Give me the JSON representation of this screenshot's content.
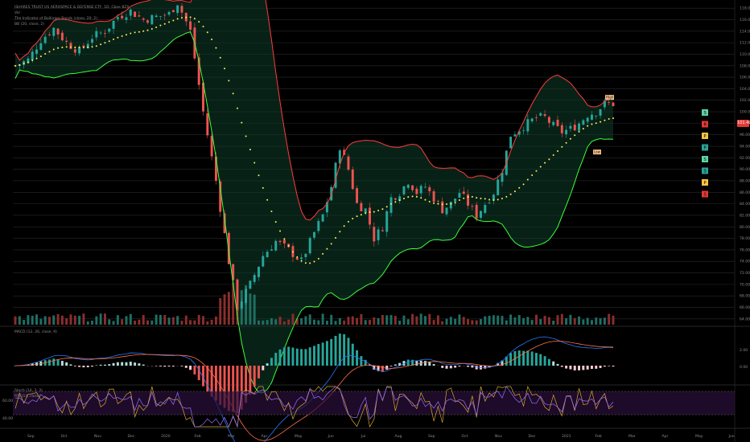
{
  "chart_data": {
    "type": "candlestick",
    "symbol_title": "ISHARES TRUST US AEROSPACE & DEFENSE ETF, 1D, Cboe BZX",
    "legend": [
      "Vol",
      "The Indicator of Bollinger Bands (close, 20, 2)",
      "BB (20, close, 2)"
    ],
    "last_price": "101.40",
    "price_ticks": [
      "118.00",
      "116.00",
      "114.00",
      "112.00",
      "110.00",
      "108.00",
      "106.00",
      "104.00",
      "102.00",
      "100.00",
      "98.00",
      "96.00",
      "94.00",
      "92.00",
      "90.00",
      "88.00",
      "86.00",
      "84.00",
      "82.00",
      "80.00",
      "78.00",
      "76.00",
      "74.00",
      "72.00",
      "70.00",
      "68.00",
      "66.00",
      "64.00"
    ],
    "ylim": [
      63,
      119
    ],
    "months": [
      "Sep",
      "Oct",
      "Nov",
      "Dec",
      "2020",
      "Feb",
      "Mar",
      "Apr",
      "May",
      "Jun",
      "Jul",
      "Aug",
      "Sep",
      "Oct",
      "Nov",
      "Dec",
      "2021",
      "Feb",
      "Mar",
      "Apr",
      "May",
      "Jun"
    ],
    "close_path": [
      [
        0,
        108
      ],
      [
        3,
        109
      ],
      [
        6,
        112.5
      ],
      [
        9,
        114.5
      ],
      [
        12,
        112
      ],
      [
        15,
        110.5
      ],
      [
        18,
        113
      ],
      [
        21,
        114
      ],
      [
        24,
        116.5
      ],
      [
        27,
        117.5
      ],
      [
        30,
        116
      ],
      [
        33,
        116.5
      ],
      [
        36,
        117
      ],
      [
        38,
        119
      ],
      [
        41,
        114
      ],
      [
        44,
        100
      ],
      [
        47,
        88
      ],
      [
        50,
        74
      ],
      [
        52,
        66
      ],
      [
        55,
        70
      ],
      [
        58,
        75
      ],
      [
        61,
        77.5
      ],
      [
        64,
        76
      ],
      [
        67,
        74
      ],
      [
        70,
        79
      ],
      [
        72,
        82
      ],
      [
        74,
        87
      ],
      [
        76,
        94
      ],
      [
        78,
        90
      ],
      [
        80,
        84
      ],
      [
        82,
        83
      ],
      [
        84,
        78
      ],
      [
        86,
        80
      ],
      [
        88,
        85
      ],
      [
        90,
        86
      ],
      [
        92,
        88
      ],
      [
        94,
        86
      ],
      [
        96,
        87
      ],
      [
        98,
        85
      ],
      [
        100,
        83
      ],
      [
        102,
        84
      ],
      [
        104,
        86
      ],
      [
        106,
        84
      ],
      [
        108,
        82
      ],
      [
        110,
        84
      ],
      [
        112,
        86
      ],
      [
        114,
        90
      ],
      [
        116,
        96
      ],
      [
        118,
        97
      ],
      [
        120,
        98
      ],
      [
        122,
        99
      ],
      [
        124,
        99
      ],
      [
        126,
        97.5
      ],
      [
        128,
        96.5
      ],
      [
        130,
        97
      ],
      [
        132,
        98
      ],
      [
        134,
        99.5
      ],
      [
        136,
        100
      ],
      [
        138,
        101.4
      ]
    ],
    "macd_ticks": [
      "2.00",
      "0.00"
    ],
    "rsi_ticks": [
      "60.00",
      "40.00"
    ],
    "macd_label": "MACD (12, 26, close, 9)",
    "rsi_label_1": "Stoch (14, 3, 3)",
    "rsi_label_2": "RSI (14, close)",
    "signal_labels": [
      "High",
      "Low"
    ],
    "side_signals": [
      "S",
      "R",
      "P",
      "P",
      "S",
      "S",
      "P",
      "S"
    ],
    "colors": {
      "bull": "#26a69a",
      "bear": "#ef5350",
      "upper": "#ff3b3b",
      "lower": "#3cff3c",
      "basis": "#ffee58",
      "macd": "#2979ff",
      "signal": "#ff7043",
      "rsi": "#9c6cff",
      "stoch": "#d4a72c"
    }
  }
}
